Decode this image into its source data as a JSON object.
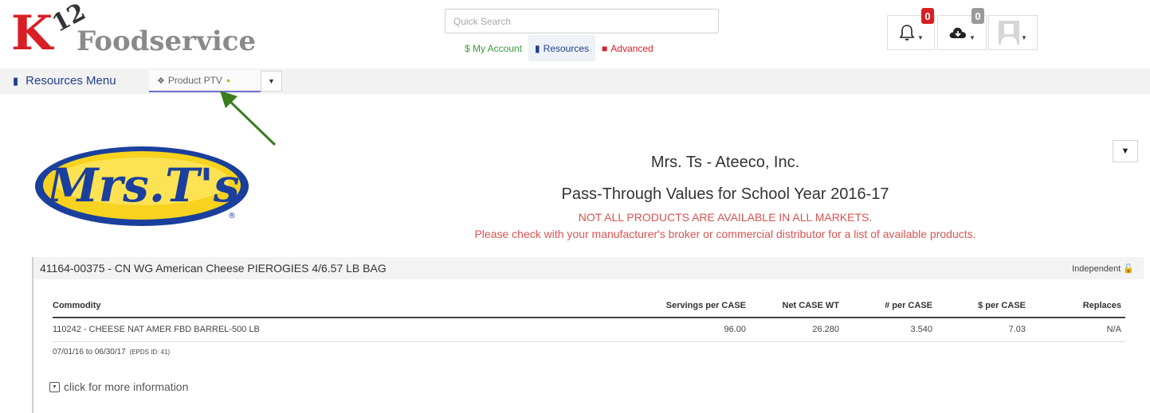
{
  "header": {
    "logo": {
      "k": "K",
      "twelve": "12",
      "tm": "™",
      "word": "Foodservice"
    },
    "search": {
      "placeholder": "Quick Search",
      "value": ""
    },
    "nav": [
      {
        "label": "$ My Account",
        "color": "#3c9a3c"
      },
      {
        "label": "Resources",
        "color": "#1f3f8f",
        "active": true
      },
      {
        "label": "Advanced",
        "color": "#d81f26"
      }
    ],
    "notifications": {
      "count": "0"
    },
    "downloads": {
      "count": "0"
    }
  },
  "subbar": {
    "resources_menu": "Resources Menu",
    "tab_label": "Product PTV"
  },
  "main": {
    "company": "Mrs. Ts - Ateeco, Inc.",
    "subtitle": "Pass-Through Values for School Year 2016-17",
    "warning_1": "NOT ALL PRODUCTS ARE AVAILABLE IN ALL MARKETS.",
    "warning_2": "Please check with your manufacturer's broker or commercial distributor for a list of available products.",
    "logo_text": "Mrs.T's"
  },
  "product": {
    "title": "41164-00375 - CN WG American Cheese PIEROGIES 4/6.57 LB BAG",
    "badge": "Independent",
    "columns": [
      "Commodity",
      "Servings per CASE",
      "Net CASE WT",
      "# per CASE",
      "$ per CASE",
      "Replaces"
    ],
    "rows": [
      [
        "110242 - CHEESE NAT AMER FBD BARREL-500 LB",
        "96.00",
        "26.280",
        "3.540",
        "7.03",
        "N/A"
      ]
    ],
    "date_range": "07/01/16 to 06/30/17",
    "epds": "(EPDS ID: 41)",
    "more_info": "click for more information"
  },
  "colors": {
    "brand_red": "#d81f26",
    "nav_blue": "#1f3f8f",
    "account_green": "#3c9a3c",
    "warning_red": "#d9534f"
  }
}
